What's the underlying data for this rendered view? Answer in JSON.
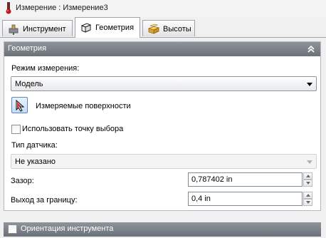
{
  "window": {
    "title": "Измерение : Измерение3"
  },
  "tabs": [
    {
      "label": "Инструмент",
      "icon": "tool-icon",
      "active": false
    },
    {
      "label": "Геометрия",
      "icon": "geometry-cube-icon",
      "active": true
    },
    {
      "label": "Высоты",
      "icon": "heights-icon",
      "active": false
    }
  ],
  "geometry": {
    "title": "Геометрия",
    "mode_label": "Режим измерения:",
    "mode_value": "Модель",
    "surfaces_label": "Измеряемые поверхности",
    "use_point_label": "Использовать точку выбора",
    "use_point_checked": false,
    "sensor_type_label": "Тип датчика:",
    "sensor_type_value": "Не указано",
    "clearance_label": "Зазор:",
    "clearance_value": "0,787402 in",
    "overshoot_label": "Выход за границу:",
    "overshoot_value": "0,4 in"
  },
  "tool_orientation": {
    "label": "Ориентация инструмента",
    "checked": false
  },
  "colors": {
    "header": "#7c8289",
    "accent": "#5b87c5"
  }
}
